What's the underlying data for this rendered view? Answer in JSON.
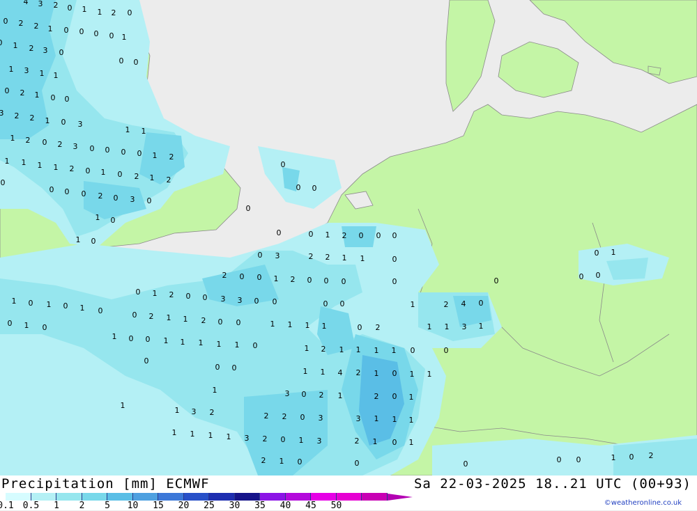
{
  "title_left": "Precipitation [mm] ECMWF",
  "title_right": "Sa 22-03-2025 18..21 UTC (00+93)",
  "credit": "©weatheronline.co.uk",
  "colors": {
    "sea": "#ececec",
    "land": "#c4f5a6",
    "border": "#8a8a8a",
    "legend": [
      "#d6fcff",
      "#b4f0f5",
      "#96e6ee",
      "#78d8ea",
      "#5abee6",
      "#4ea0e0",
      "#3c78d8",
      "#2850c8",
      "#1e2eb0",
      "#16148a",
      "#8c14e6",
      "#b40adc",
      "#e600e6",
      "#e600d2",
      "#c800b4"
    ]
  },
  "legend_labels": [
    "0.1",
    "0.5",
    "1",
    "2",
    "5",
    "10",
    "15",
    "20",
    "25",
    "30",
    "35",
    "40",
    "45",
    "50"
  ],
  "map_values": [
    "4",
    "3",
    "2",
    "0",
    "1",
    "1",
    "2",
    "0",
    "0",
    "2",
    "2",
    "1",
    "0",
    "0",
    "0",
    "0",
    "1",
    "0",
    "1",
    "2",
    "3",
    "0",
    "1",
    "3",
    "1",
    "1",
    "0",
    "2",
    "1",
    "0",
    "0",
    "3",
    "2",
    "2",
    "1",
    "0",
    "3",
    "1",
    "2",
    "0",
    "2",
    "3",
    "0",
    "0",
    "0",
    "0",
    "1",
    "2",
    "1",
    "1",
    "1",
    "1",
    "1",
    "1",
    "2",
    "0",
    "1",
    "0",
    "2",
    "1",
    "2",
    "0",
    "0",
    "0",
    "2",
    "0",
    "3",
    "0",
    "0",
    "0",
    "1",
    "0",
    "1",
    "0",
    "0",
    "0",
    "0",
    "0",
    "0",
    "0",
    "0",
    "1",
    "2",
    "0",
    "0",
    "0",
    "0",
    "3",
    "2",
    "2",
    "1",
    "1",
    "0",
    "2",
    "0",
    "0",
    "1",
    "2",
    "0",
    "0",
    "0",
    "0",
    "0",
    "1",
    "2",
    "0",
    "0",
    "3",
    "3",
    "0",
    "0",
    "1",
    "0",
    "1",
    "0",
    "1",
    "0",
    "0",
    "0",
    "1",
    "2",
    "4",
    "0",
    "0",
    "2",
    "1",
    "1",
    "2",
    "0",
    "0",
    "1",
    "1",
    "1",
    "1",
    "1",
    "1",
    "3",
    "1",
    "0",
    "1",
    "0",
    "1",
    "0",
    "0",
    "1",
    "1",
    "1",
    "1",
    "1",
    "0",
    "0",
    "2",
    "1",
    "2",
    "1",
    "1",
    "1",
    "1",
    "0",
    "0",
    "0",
    "0",
    "0",
    "1",
    "1",
    "4",
    "2",
    "1",
    "0",
    "1",
    "1",
    "1",
    "3",
    "0",
    "2",
    "1",
    "2",
    "0",
    "1",
    "1",
    "1",
    "3",
    "2",
    "2",
    "2",
    "0",
    "3",
    "3",
    "1",
    "1",
    "1",
    "1",
    "1",
    "1",
    "1",
    "3",
    "2",
    "0",
    "1",
    "3",
    "2",
    "1",
    "0",
    "1",
    "2",
    "1",
    "0",
    "0",
    "0",
    "0",
    "0",
    "1",
    "0",
    "2",
    "0",
    "0",
    "1",
    "0",
    "0"
  ]
}
